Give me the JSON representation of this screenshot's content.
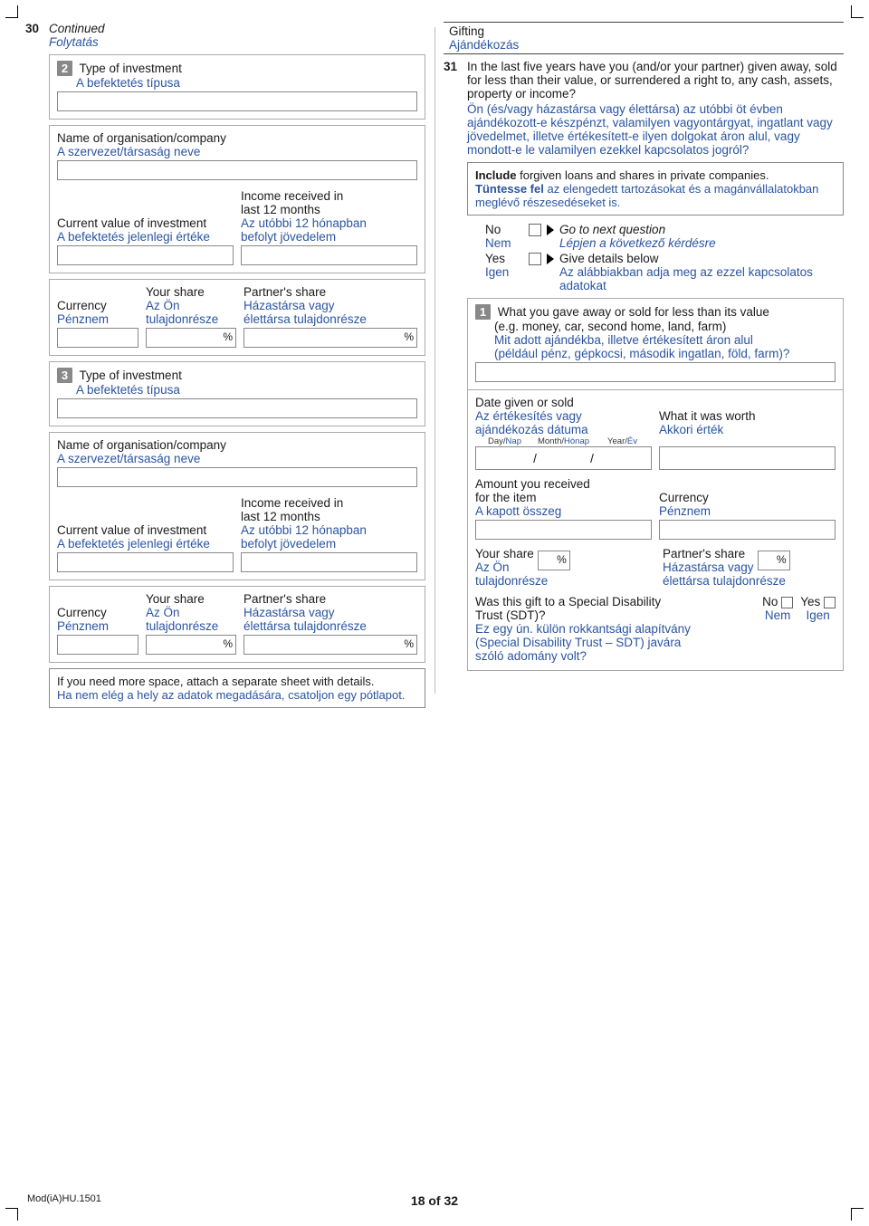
{
  "q30": {
    "num": "30",
    "continued_en": "Continued",
    "continued_hu": "Folytatás",
    "blocks": [
      {
        "badge": "2",
        "type_en": "Type of investment",
        "type_hu": "A befektetés típusa",
        "org_en": "Name of organisation/company",
        "org_hu": "A szervezet/társaság neve",
        "curval_en": "Current value of investment",
        "curval_hu": "A befektetés jelenlegi értéke",
        "income_en1": "Income received in",
        "income_en2": "last 12 months",
        "income_hu1": "Az utóbbi 12 hónapban",
        "income_hu2": "befolyt jövedelem",
        "currency_en": "Currency",
        "currency_hu": "Pénznem",
        "yourshare_en": "Your share",
        "yourshare_hu1": "Az Ön",
        "yourshare_hu2": "tulajdonrésze",
        "partnershare_en": "Partner's share",
        "partnershare_hu1": "Házastársa vagy",
        "partnershare_hu2": "élettársa tulajdonrésze"
      },
      {
        "badge": "3",
        "type_en": "Type of investment",
        "type_hu": "A befektetés típusa",
        "org_en": "Name of organisation/company",
        "org_hu": "A szervezet/társaság neve",
        "curval_en": "Current value of investment",
        "curval_hu": "A befektetés jelenlegi értéke",
        "income_en1": "Income received in",
        "income_en2": "last 12 months",
        "income_hu1": "Az utóbbi 12 hónapban",
        "income_hu2": "befolyt jövedelem",
        "currency_en": "Currency",
        "currency_hu": "Pénznem",
        "yourshare_en": "Your share",
        "yourshare_hu1": "Az Ön",
        "yourshare_hu2": "tulajdonrésze",
        "partnershare_en": "Partner's share",
        "partnershare_hu1": "Házastársa vagy",
        "partnershare_hu2": "élettársa tulajdonrésze"
      }
    ],
    "morespace_en": "If you need more space, attach a separate sheet with details.",
    "morespace_hu": "Ha nem elég a hely az adatok megadására, csatoljon egy pótlapot."
  },
  "gifting": {
    "title_en": "Gifting",
    "title_hu": "Ajándékozás"
  },
  "q31": {
    "num": "31",
    "q_en": "In the last five years have you (and/or your partner) given away, sold for less than their value, or surrendered a right to, any cash, assets, property or income?",
    "q_hu": "Ön (és/vagy házastársa vagy élettársa) az utóbbi öt évben ajándékozott-e készpénzt, valamilyen vagyontárgyat, ingatlant vagy jövedelmet, illetve értékesített-e ilyen dolgokat áron alul, vagy mondott-e le valamilyen ezekkel kapcsolatos jogról?",
    "include_en1": "Include",
    "include_en2": " forgiven loans and shares in private companies.",
    "include_hu1": "Tüntesse fel",
    "include_hu2": " az elengedett tartozásokat és a magánvállalatokban meglévő részesedéseket is.",
    "no_en": "No",
    "no_hu": "Nem",
    "yes_en": "Yes",
    "yes_hu": "Igen",
    "no_goto_en": "Go to next question",
    "no_goto_hu": "Lépjen a következő kérdésre",
    "yes_give_en": "Give details below",
    "yes_give_hu": "Az alábbiakban adja meg az ezzel kapcsolatos adatokat",
    "item": {
      "badge": "1",
      "what_en": "What you gave away or sold for less than its value",
      "what_eg_en": "(e.g. money, car, second home, land, farm)",
      "what_hu1": "Mit adott ajándékba, illetve értékesített áron alul",
      "what_hu2": "(például pénz, gépkocsi, második ingatlan, föld, farm)?",
      "date_en": "Date given or sold",
      "date_hu1": "Az értékesítés vagy",
      "date_hu2": "ajándékozás dátuma",
      "day_en": "Day",
      "day_hu": "Nap",
      "month_en": "Month",
      "month_hu": "Hónap",
      "year_en": "Year",
      "year_hu": "Év",
      "worth_en": "What it was worth",
      "worth_hu": "Akkori érték",
      "amount_en1": "Amount you received",
      "amount_en2": "for the item",
      "amount_hu": "A kapott összeg",
      "currency_en": "Currency",
      "currency_hu": "Pénznem",
      "yourshare_en": "Your share",
      "yourshare_hu1": "Az Ön",
      "yourshare_hu2": "tulajdonrésze",
      "partnershare_en": "Partner's share",
      "partnershare_hu1": "Házastársa vagy",
      "partnershare_hu2": "élettársa tulajdonrésze",
      "sdt_en1": "Was this gift to a Special Disability",
      "sdt_en2": "Trust (SDT)?",
      "sdt_hu1": "Ez egy ún. külön rokkantsági alapítvány",
      "sdt_hu2": "(Special Disability Trust – SDT) javára",
      "sdt_hu3": "szóló adomány volt?",
      "no_en": "No",
      "no_hu": "Nem",
      "yes_en": "Yes",
      "yes_hu": "Igen"
    }
  },
  "footer": {
    "code": "Mod(iA)HU.1501",
    "page": "18 of 32"
  },
  "pct": "%",
  "slash": "/"
}
